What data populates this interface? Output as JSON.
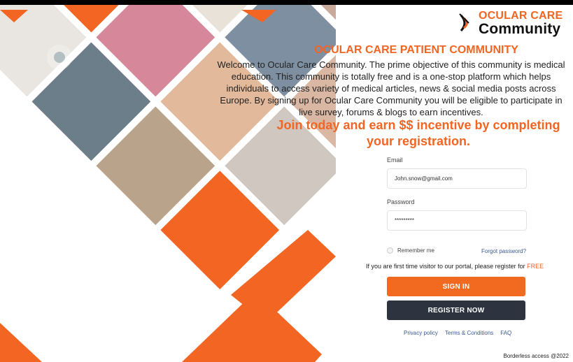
{
  "brand": {
    "line1": "OCULAR CARE",
    "line2": "Community",
    "accent": "#f26522"
  },
  "headline": "OCULAR CARE PATIENT COMMUNITY",
  "intro": "Welcome to Ocular Care Community. The prime objective of this community is medical education. This community is totally free and is a one-stop platform which helps individuals to access variety of medical articles, news & social media posts across Europe. By signing up for Ocular Care Community you will be eligible to participate in live survey, forums & blogs to earn incentives.",
  "promo": "Join today and earn $$ incentive by completing your registration.",
  "form": {
    "email_label": "Email",
    "email_value": "John.snow@gmail.com",
    "password_label": "Password",
    "password_value": "*********",
    "remember_label": "Remember me",
    "forgot_label": "Forgot password?",
    "visitor_text": "If you are first time visitor to our portal, please register for ",
    "visitor_free": "FREE",
    "signin_label": "SIGN IN",
    "register_label": "REGISTER NOW"
  },
  "footer": {
    "links": [
      "Privacy policy",
      "Terms & Conditions",
      "FAQ"
    ],
    "copyright": "Borderless access @2022"
  },
  "colors": {
    "orange": "#f26a1f",
    "dark_button": "#2d3440",
    "link": "#3b5998"
  },
  "collage_photos": [
    "eye-closeup",
    "man-with-glasses",
    "woman-rubbing-eyes",
    "elderly-man-driving",
    "woman-reading-newspaper",
    "man-pressing-nose",
    "woman-holding-flowers",
    "woman-profile",
    "woman-rubbing-eyes-2",
    "elderly-man-holding-head",
    "woman-covering-face"
  ]
}
